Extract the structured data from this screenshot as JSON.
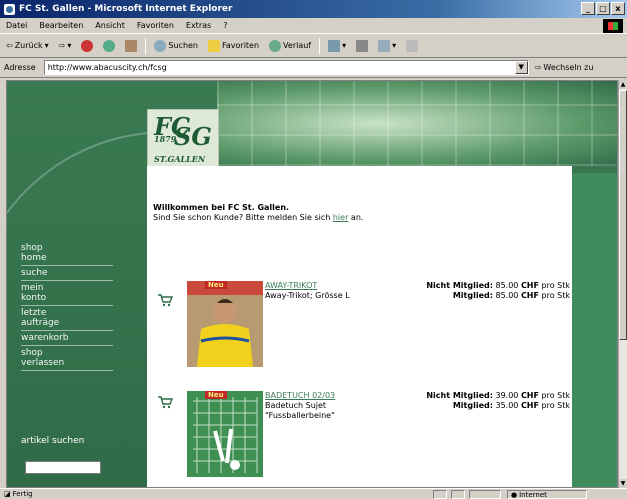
{
  "window": {
    "title": "FC St. Gallen - Microsoft Internet Explorer",
    "minimize": "_",
    "maximize": "□",
    "close": "x"
  },
  "menu": [
    "Datei",
    "Bearbeiten",
    "Ansicht",
    "Favoriten",
    "Extras",
    "?"
  ],
  "toolbar": {
    "back": "Zurück",
    "search": "Suchen",
    "favorites": "Favoriten",
    "history": "Verlauf"
  },
  "address": {
    "label": "Adresse",
    "url": "http://www.abacuscity.ch/fcsg",
    "go": "Wechseln zu"
  },
  "logo": {
    "fc": "FC",
    "sg": "SG",
    "year": "1879",
    "city": "ST.GALLEN"
  },
  "nav": [
    {
      "line1": "shop",
      "line2": "home"
    },
    {
      "line1": "suche",
      "line2": ""
    },
    {
      "line1": "mein",
      "line2": "konto"
    },
    {
      "line1": "letzte",
      "line2": "aufträge"
    },
    {
      "line1": "warenkorb",
      "line2": ""
    },
    {
      "line1": "shop",
      "line2": "verlassen"
    }
  ],
  "search": {
    "label": "artikel suchen",
    "value": ""
  },
  "welcome": {
    "heading": "Willkommen bei FC St. Gallen.",
    "text_before": "Sind Sie schon Kunde? Bitte melden Sie sich ",
    "link": "hier",
    "text_after": " an."
  },
  "products": [
    {
      "badge": "Neu",
      "name": "AWAY-TRIKOT",
      "desc1": "Away-Trikot; Grösse L",
      "desc2": "",
      "price_nonmember_label": "Nicht Mitglied:",
      "price_nonmember": "85.00",
      "price_member_label": "Mitglied:",
      "price_member": "85.00",
      "currency": "CHF",
      "unit": "pro Stk"
    },
    {
      "badge": "Neu",
      "name": "BADETUCH 02/03",
      "desc1": "Badetuch Sujet",
      "desc2": "\"Fussballerbeine\"",
      "price_nonmember_label": "Nicht Mitglied:",
      "price_nonmember": "39.00",
      "price_member_label": "Mitglied:",
      "price_member": "35.00",
      "currency": "CHF",
      "unit": "pro Stk"
    }
  ],
  "status": {
    "left": "Fertig",
    "zone": "Internet"
  },
  "colors": {
    "brand_green": "#3a7a52",
    "panel_green": "#3f8b5b",
    "new_badge": "#c32626"
  }
}
